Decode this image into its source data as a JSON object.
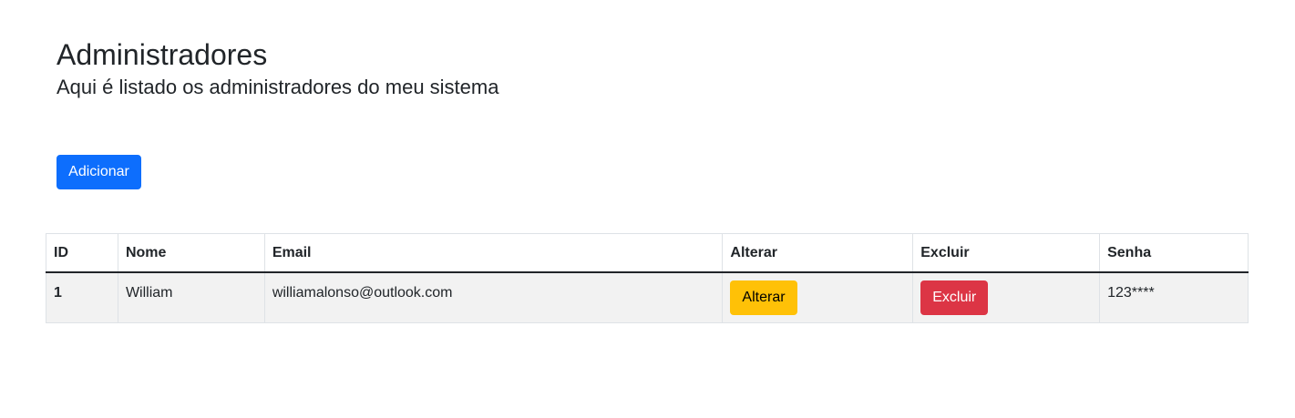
{
  "header": {
    "title": "Administradores",
    "subtitle": "Aqui é listado os administradores do meu sistema"
  },
  "toolbar": {
    "add_label": "Adicionar"
  },
  "table": {
    "columns": [
      "ID",
      "Nome",
      "Email",
      "Alterar",
      "Excluir",
      "Senha"
    ],
    "rows": [
      {
        "id": "1",
        "nome": "William",
        "email": "williamalonso@outlook.com",
        "alterar_label": "Alterar",
        "excluir_label": "Excluir",
        "senha": "123****"
      }
    ]
  },
  "colors": {
    "primary": "#0d6efd",
    "warning": "#ffc107",
    "danger": "#dc3545",
    "row_stripe": "#f2f2f2"
  }
}
